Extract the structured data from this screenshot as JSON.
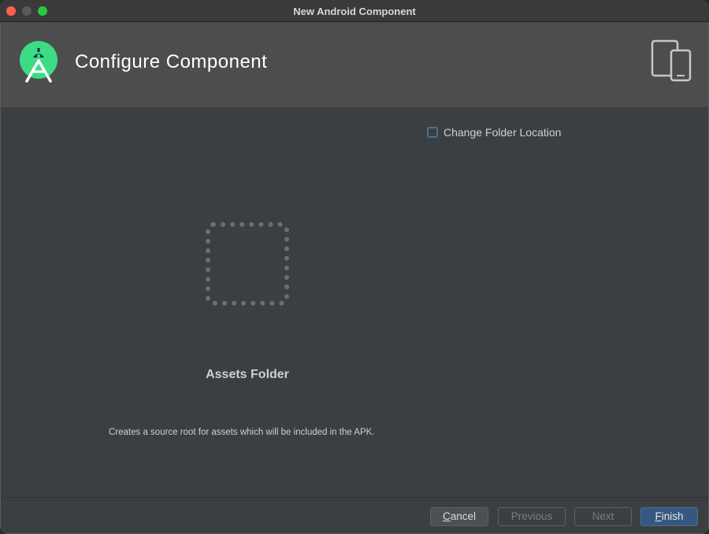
{
  "window": {
    "title": "New Android Component"
  },
  "header": {
    "title": "Configure Component",
    "logo_icon": "android-studio-logo-icon",
    "device_icon": "phone-tablet-icon"
  },
  "content": {
    "change_folder_label": "Change Folder Location",
    "change_folder_checked": false,
    "component_name": "Assets Folder",
    "description": "Creates a source root for assets which will be included in the APK."
  },
  "footer": {
    "cancel": {
      "mnemonic": "C",
      "rest": "ancel"
    },
    "previous": "Previous",
    "next": "Next",
    "finish": {
      "mnemonic": "F",
      "rest": "inish"
    }
  },
  "colors": {
    "accent": "#365880",
    "logo_green": "#3ddc84",
    "header_bg": "#4d4d4d",
    "panel_bg": "#3c3f41"
  }
}
